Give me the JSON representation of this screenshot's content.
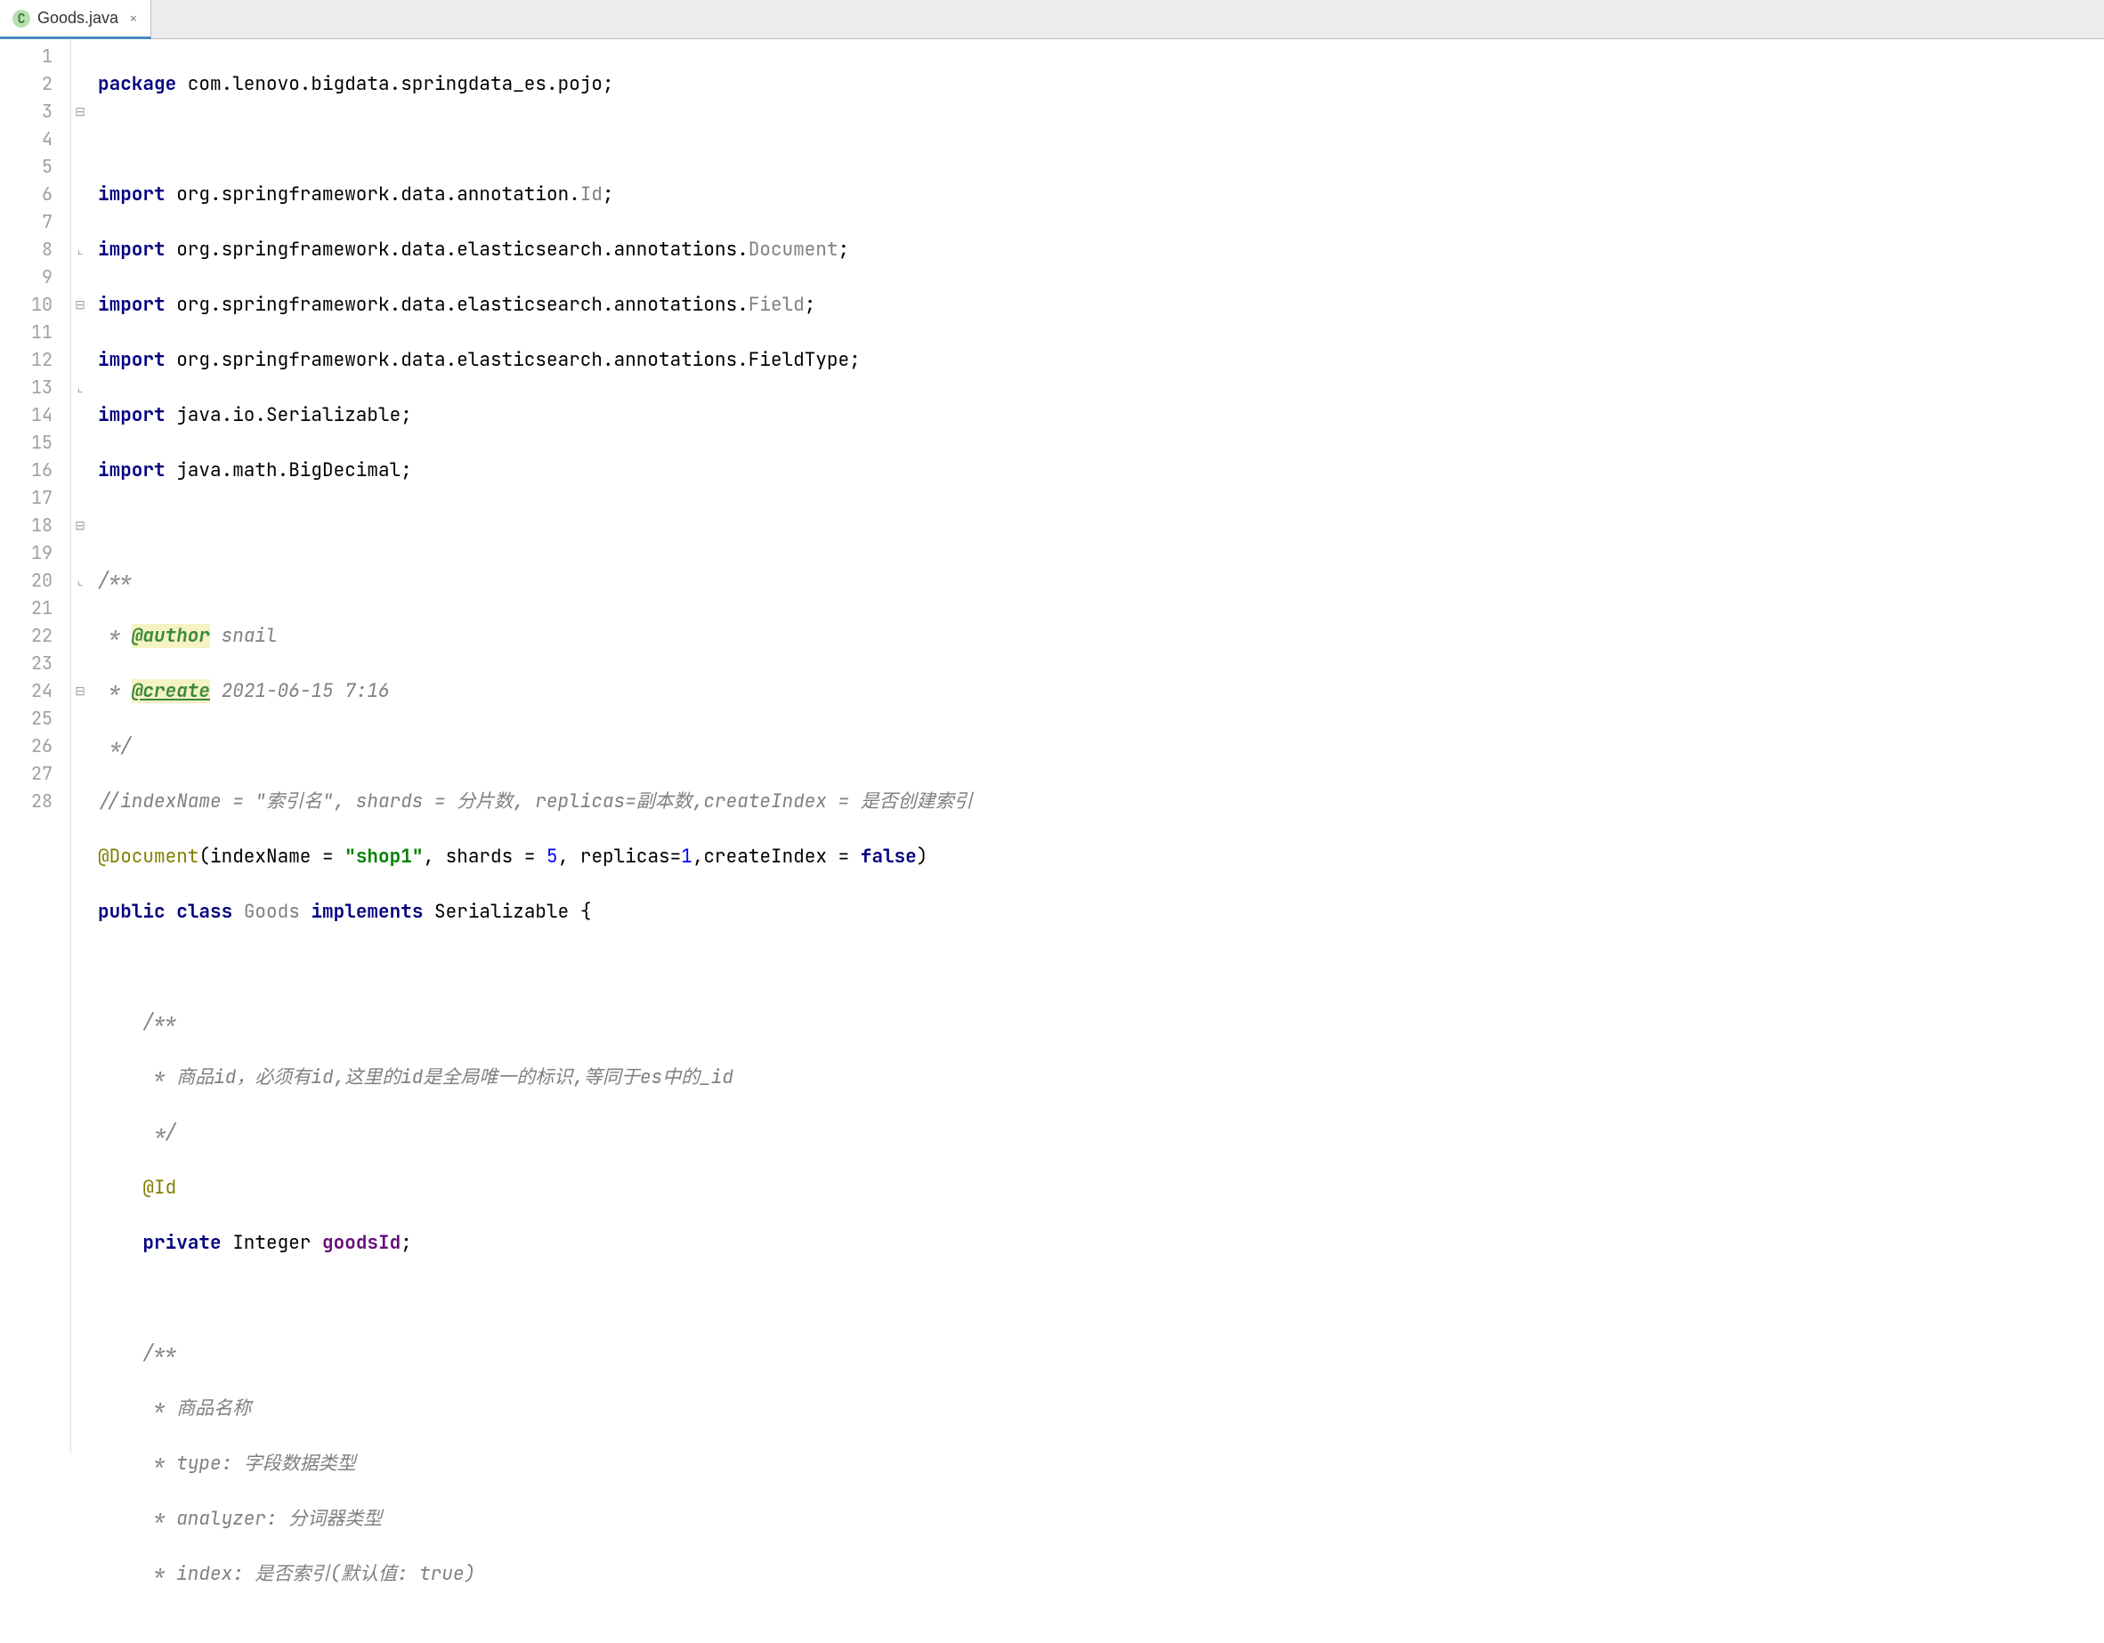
{
  "tab": {
    "icon_letter": "C",
    "label": "Goods.java",
    "close": "×"
  },
  "gutter": {
    "lines": [
      "1",
      "2",
      "3",
      "4",
      "5",
      "6",
      "7",
      "8",
      "9",
      "10",
      "11",
      "12",
      "13",
      "14",
      "15",
      "16",
      "17",
      "18",
      "19",
      "20",
      "21",
      "22",
      "23",
      "24",
      "25",
      "26",
      "27",
      "28"
    ]
  },
  "code": {
    "l1": {
      "kw": "package",
      "pkg": " com.lenovo.bigdata.springdata_es.pojo;"
    },
    "l3": {
      "kw": "import",
      "pkg": " org.springframework.data.annotation.",
      "cls": "Id",
      "semi": ";"
    },
    "l4": {
      "kw": "import",
      "pkg": " org.springframework.data.elasticsearch.annotations.",
      "cls": "Document",
      "semi": ";"
    },
    "l5": {
      "kw": "import",
      "pkg": " org.springframework.data.elasticsearch.annotations.",
      "cls": "Field",
      "semi": ";"
    },
    "l6": {
      "kw": "import",
      "pkg": " org.springframework.data.elasticsearch.annotations.FieldType;"
    },
    "l7": {
      "kw": "import",
      "pkg": " java.io.Serializable;"
    },
    "l8": {
      "kw": "import",
      "pkg": " java.math.BigDecimal;"
    },
    "l10": "/**",
    "l11": {
      "pre": " * ",
      "tag": "@author",
      "rest": " snail"
    },
    "l12": {
      "pre": " * ",
      "tag": "@create",
      "rest": " 2021-06-15 7:16"
    },
    "l13": " */",
    "l14": "//indexName = \"索引名\", shards = 分片数, replicas=副本数,createIndex = 是否创建索引",
    "l15": {
      "ann": "@Document",
      "p1": "(indexName = ",
      "s1": "\"shop1\"",
      "p2": ", shards = ",
      "n1": "5",
      "p3": ", replicas=",
      "n2": "1",
      "p4": ",createIndex = ",
      "kw": "false",
      "p5": ")"
    },
    "l16": {
      "kw1": "public",
      "sp1": " ",
      "kw2": "class",
      "sp2": " ",
      "cls": "Goods",
      "sp3": " ",
      "kw3": "implements",
      "sp4": " Serializable {"
    },
    "l18": "    /**",
    "l19": "     * 商品id，必须有id,这里的id是全局唯一的标识,等同于es中的_id",
    "l20": "     */",
    "l21": {
      "ind": "    ",
      "ann": "@Id"
    },
    "l22": {
      "ind": "    ",
      "kw": "private",
      "typ": " Integer ",
      "mem": "goodsId",
      "semi": ";"
    },
    "l24": "    /**",
    "l25": "     * 商品名称",
    "l26": "     * type: 字段数据类型",
    "l27": "     * analyzer: 分词器类型",
    "l28": "     * index: 是否索引(默认值: true)"
  }
}
